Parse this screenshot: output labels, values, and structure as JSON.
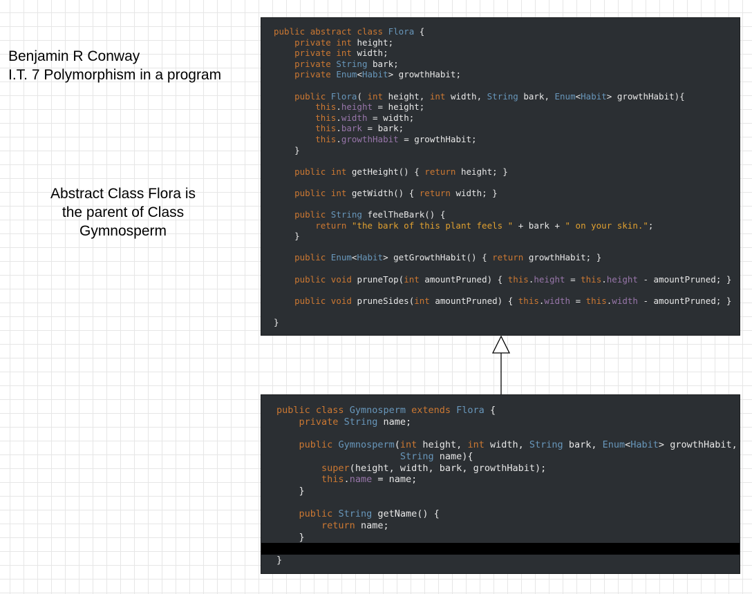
{
  "notes": {
    "author": "Benjamin R Conway",
    "assignment": "I.T. 7 Polymorphism in a program",
    "relation_line1": "Abstract Class Flora is",
    "relation_line2": "the parent of Class",
    "relation_line3": "Gymnosperm"
  },
  "flora_code": {
    "lines": [
      "public abstract class Flora {",
      "    private int height;",
      "    private int width;",
      "    private String bark;",
      "    private Enum<Habit> growthHabit;",
      "",
      "    public Flora( int height, int width, String bark, Enum<Habit> growthHabit){",
      "        this.height = height;",
      "        this.width = width;",
      "        this.bark = bark;",
      "        this.growthHabit = growthHabit;",
      "    }",
      "",
      "    public int getHeight() { return height; }",
      "",
      "    public int getWidth() { return width; }",
      "",
      "    public String feelTheBark() {",
      "        return \"the bark of this plant feels \" + bark + \" on your skin.\";",
      "    }",
      "",
      "    public Enum<Habit> getGrowthHabit() { return growthHabit; }",
      "",
      "    public void pruneTop(int amountPruned) { this.height = this.height - amountPruned; }",
      "",
      "    public void pruneSides(int amountPruned) { this.width = this.width - amountPruned; }",
      "",
      "}"
    ]
  },
  "gymnosperm_code": {
    "lines": [
      "public class Gymnosperm extends Flora {",
      "    private String name;",
      "",
      "    public Gymnosperm(int height, int width, String bark, Enum<Habit> growthHabit,",
      "                      String name){",
      "        super(height, width, bark, growthHabit);",
      "        this.name = name;",
      "    }",
      "",
      "    public String getName() {",
      "        return name;",
      "    }",
      "",
      "}"
    ],
    "cursor_line_index": 12
  },
  "colors": {
    "editor_background": "#2b2f33",
    "keyword": "#cc7832",
    "type": "#6897bb",
    "field": "#9876aa",
    "string": "#e0a030",
    "text": "#e8e8e8",
    "cursor_line": "#000000"
  },
  "relationship": {
    "type": "inheritance",
    "icon": "hollow-triangle-arrow"
  }
}
